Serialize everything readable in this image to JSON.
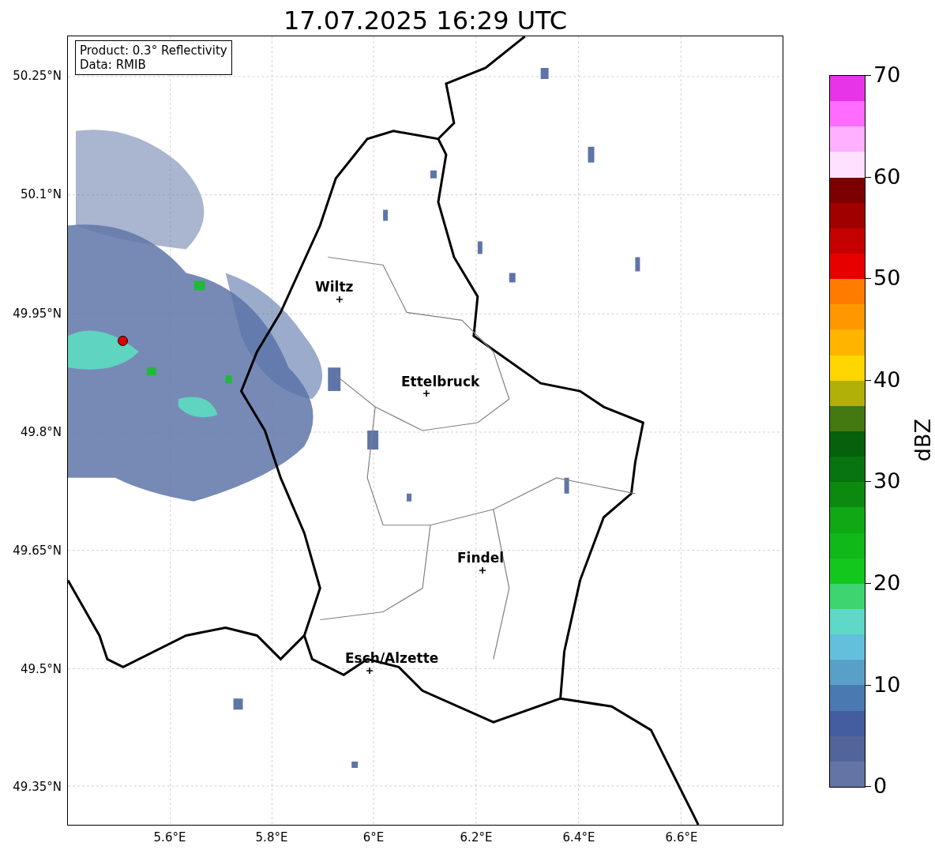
{
  "title": "17.07.2025 16:29 UTC",
  "info_box": [
    "Product: 0.3° Reflectivity",
    "Data: RMIB"
  ],
  "y_ticks": [
    "50.25°N",
    "50.1°N",
    "49.95°N",
    "49.8°N",
    "49.65°N",
    "49.5°N",
    "49.35°N"
  ],
  "x_ticks": [
    "5.6°E",
    "5.8°E",
    "6°E",
    "6.2°E",
    "6.4°E",
    "6.6°E"
  ],
  "cities": [
    {
      "name": "Wiltz"
    },
    {
      "name": "Ettelbruck"
    },
    {
      "name": "Findel"
    },
    {
      "name": "Esch/Alzette"
    }
  ],
  "colorbar": {
    "label": "dBZ",
    "ticks": [
      "70",
      "60",
      "50",
      "40",
      "30",
      "20",
      "10",
      "0"
    ],
    "bands": [
      {
        "color": "#6474a4"
      },
      {
        "color": "#52659a"
      },
      {
        "color": "#435da0"
      },
      {
        "color": "#4a78b0"
      },
      {
        "color": "#58a0c8"
      },
      {
        "color": "#62c0dc"
      },
      {
        "color": "#60d8c8"
      },
      {
        "color": "#3ed470"
      },
      {
        "color": "#12c81c"
      },
      {
        "color": "#10b81a"
      },
      {
        "color": "#10a814"
      },
      {
        "color": "#0c8a10"
      },
      {
        "color": "#087410"
      },
      {
        "color": "#06600c"
      },
      {
        "color": "#447810"
      },
      {
        "color": "#b0b008"
      },
      {
        "color": "#ffd600"
      },
      {
        "color": "#ffb400"
      },
      {
        "color": "#ff9800"
      },
      {
        "color": "#ff7c00"
      },
      {
        "color": "#e60000"
      },
      {
        "color": "#c40000"
      },
      {
        "color": "#a00000"
      },
      {
        "color": "#7c0000"
      },
      {
        "color": "#ffe0ff"
      },
      {
        "color": "#ffb0ff"
      },
      {
        "color": "#ff6cff"
      },
      {
        "color": "#e834e8"
      }
    ]
  }
}
